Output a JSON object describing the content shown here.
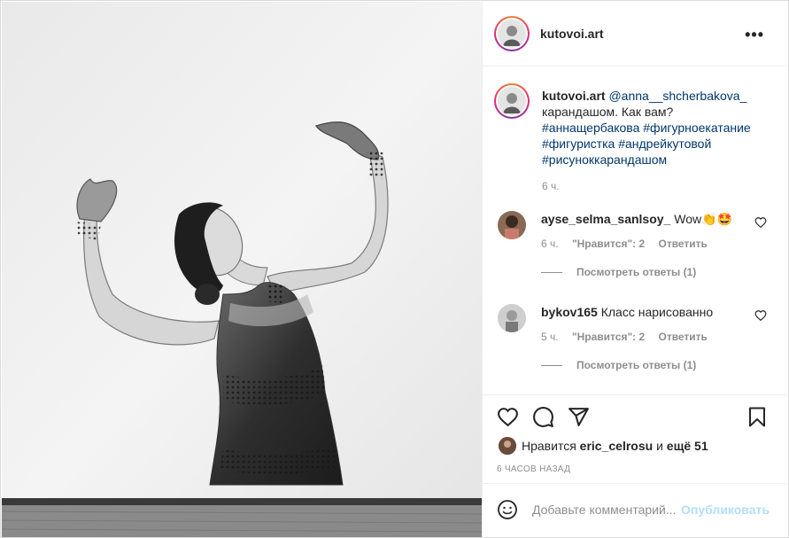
{
  "post": {
    "username": "kutovoi.art",
    "more_label": "•••"
  },
  "caption": {
    "username": "kutovoi.art",
    "mention": "@anna__shcherbakova_",
    "text": "карандашом. Как вам?",
    "hashtags_line1": "#аннащербакова #фигурноекатание",
    "hashtags_line2": "#фигуристка #андрейкутовой",
    "hashtags_line3": "#рисуноккарандашом",
    "time": "6 ч."
  },
  "comments": [
    {
      "username": "ayse_selma_sanlsoy_",
      "text": "Wow👏🤩",
      "time": "6 ч.",
      "likes": "\"Нравится\": 2",
      "reply": "Ответить",
      "view_replies": "Посмотреть ответы (1)"
    },
    {
      "username": "bykov165",
      "text": "Класс нарисованно",
      "time": "5 ч.",
      "likes": "\"Нравится\": 2",
      "reply": "Ответить",
      "view_replies": "Посмотреть ответы (1)"
    }
  ],
  "likes": {
    "prefix": "Нравится",
    "user": "eric_celrosu",
    "and": "и",
    "others": "ещё 51"
  },
  "posted_ago": "6 ЧАСОВ НАЗАД",
  "add_comment": {
    "placeholder": "Добавьте комментарий...",
    "post_label": "Опубликовать"
  },
  "icons": [
    "heart-icon",
    "comment-icon",
    "share-icon",
    "bookmark-icon",
    "smile-icon",
    "more-icon"
  ]
}
